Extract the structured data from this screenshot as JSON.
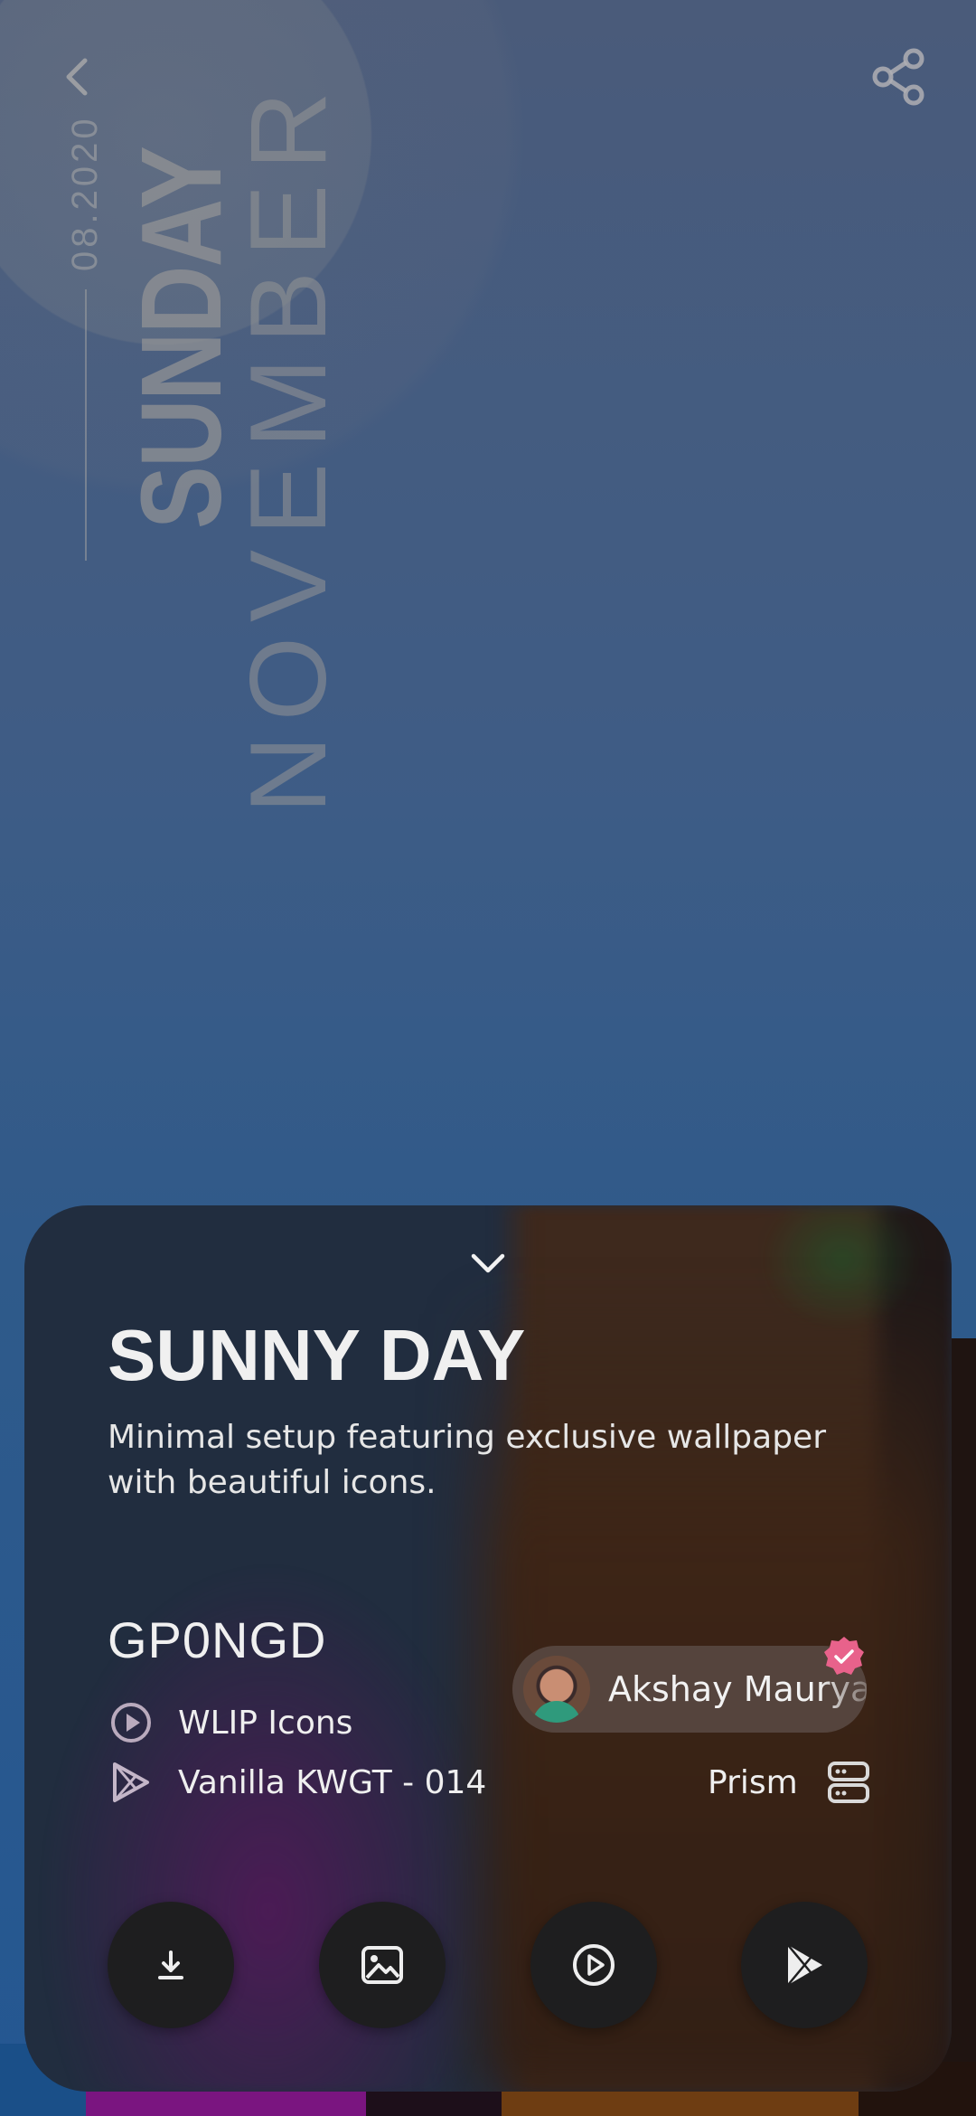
{
  "wallpaper_widget": {
    "date": "08.2020",
    "day": "SUNDAY",
    "month": "NOVEMBER"
  },
  "top_bar": {
    "back_icon": "chevron-left-icon",
    "share_icon": "share-icon"
  },
  "setup": {
    "title": "SUNNY DAY",
    "description": "Minimal setup featuring exclusive wallpaper with beautiful icons.",
    "code": "GP0NGD",
    "apps": [
      {
        "icon": "play-circle-icon",
        "label": "WLIP Icons"
      },
      {
        "icon": "play-store-icon",
        "label": "Vanilla KWGT - 014"
      }
    ],
    "author": {
      "name": "Akshay Maurya",
      "verified": true
    },
    "source": {
      "label": "Prism",
      "icon": "server-icon"
    },
    "actions": [
      {
        "icon": "download-icon"
      },
      {
        "icon": "image-icon"
      },
      {
        "icon": "play-circle-icon"
      },
      {
        "icon": "play-store-icon"
      }
    ]
  },
  "colors": {
    "sheet": "#243247",
    "action_button": "#1e1e1f",
    "verified_badge": "#e8628b",
    "text": "#f0f0f0"
  }
}
